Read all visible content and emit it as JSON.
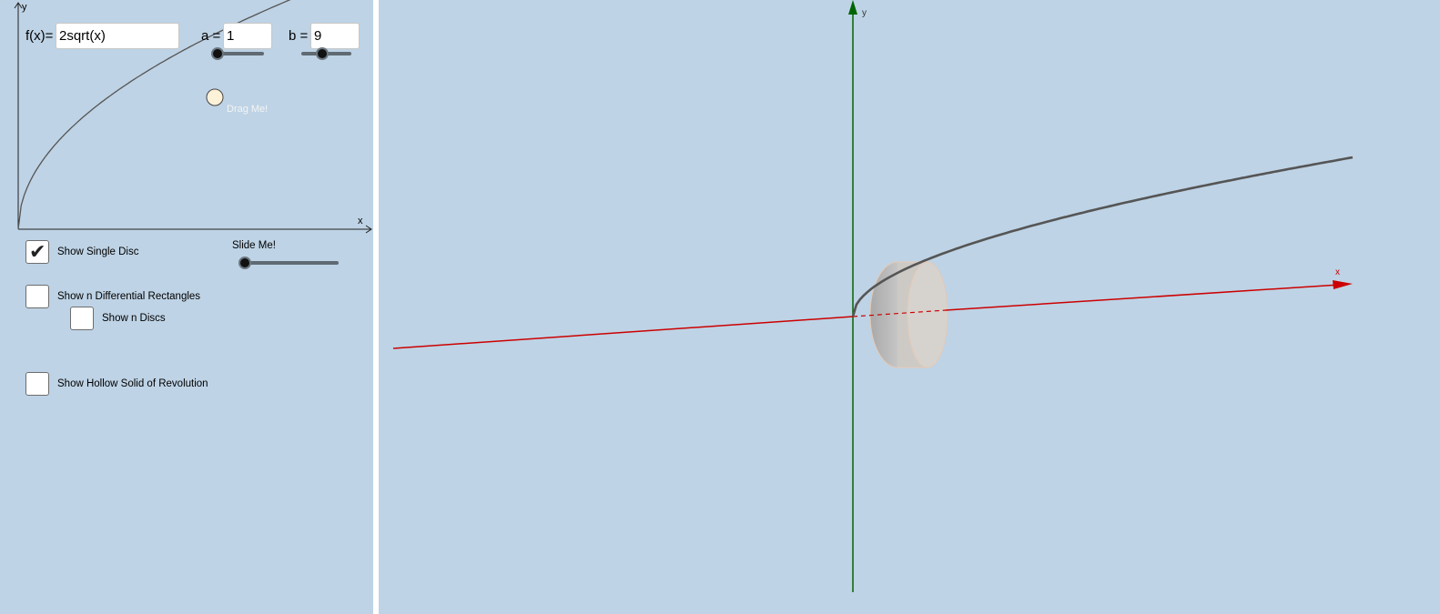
{
  "graph2d": {
    "x_axis_label": "x",
    "y_axis_label": "y",
    "drag_label": "Drag Me!",
    "function_label": "f(x)=",
    "function_value": "2sqrt(x)"
  },
  "params": {
    "a_label": "a =",
    "a_value": "1",
    "b_label": "b =",
    "b_value": "9",
    "slide_label": "Slide Me!"
  },
  "options": {
    "single_disc": {
      "label": "Show Single Disc",
      "checked": true,
      "mark": "✔"
    },
    "diff_rects": {
      "label": "Show n Differential Rectangles",
      "checked": false
    },
    "n_discs": {
      "label": "Show n Discs",
      "checked": false
    },
    "hollow_solid": {
      "label": "Show Hollow Solid of Revolution",
      "checked": false
    }
  },
  "view3d": {
    "x_axis_label": "x",
    "y_axis_label": "y"
  },
  "colors": {
    "background": "#bed3e5",
    "x_axis_3d": "#cc0000",
    "y_axis_3d": "#006400",
    "curve": "#555555",
    "drag_point": "#fdf1d8"
  }
}
